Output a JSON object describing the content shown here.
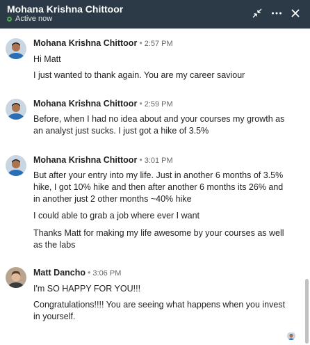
{
  "header": {
    "name": "Mohana Krishna Chittoor",
    "status": "Active now",
    "icons": [
      "compress-icon",
      "more-icon",
      "close-icon"
    ]
  },
  "messages": [
    {
      "author": "Mohana Krishna Chittoor",
      "time": "2:57 PM",
      "lines": [
        "Hi Matt",
        "I just wanted to thank again. You are my career saviour"
      ]
    },
    {
      "author": "Mohana Krishna Chittoor",
      "time": "2:59 PM",
      "lines": [
        "Before, when I had no idea about and your courses my growth as an analyst just sucks. I just got a hike of 3.5%"
      ]
    },
    {
      "author": "Mohana Krishna Chittoor",
      "time": "3:01 PM",
      "lines": [
        "But after your entry into my life. Just in another 6 months of 3.5% hike, I got 10% hike and then after another 6 months its 26% and in another just 2 other months ~40% hike",
        "I could able to grab a job where ever I want",
        "Thanks Matt for making my life awesome by your courses as well as the labs"
      ]
    },
    {
      "author": "Matt Dancho",
      "time": "3:06 PM",
      "lines": [
        "I'm SO HAPPY FOR YOU!!!",
        "Congratulations!!!! You are seeing what happens when you invest in yourself."
      ]
    }
  ],
  "colors": {
    "header_bg": "#2b3a46",
    "active": "#4caf50"
  }
}
